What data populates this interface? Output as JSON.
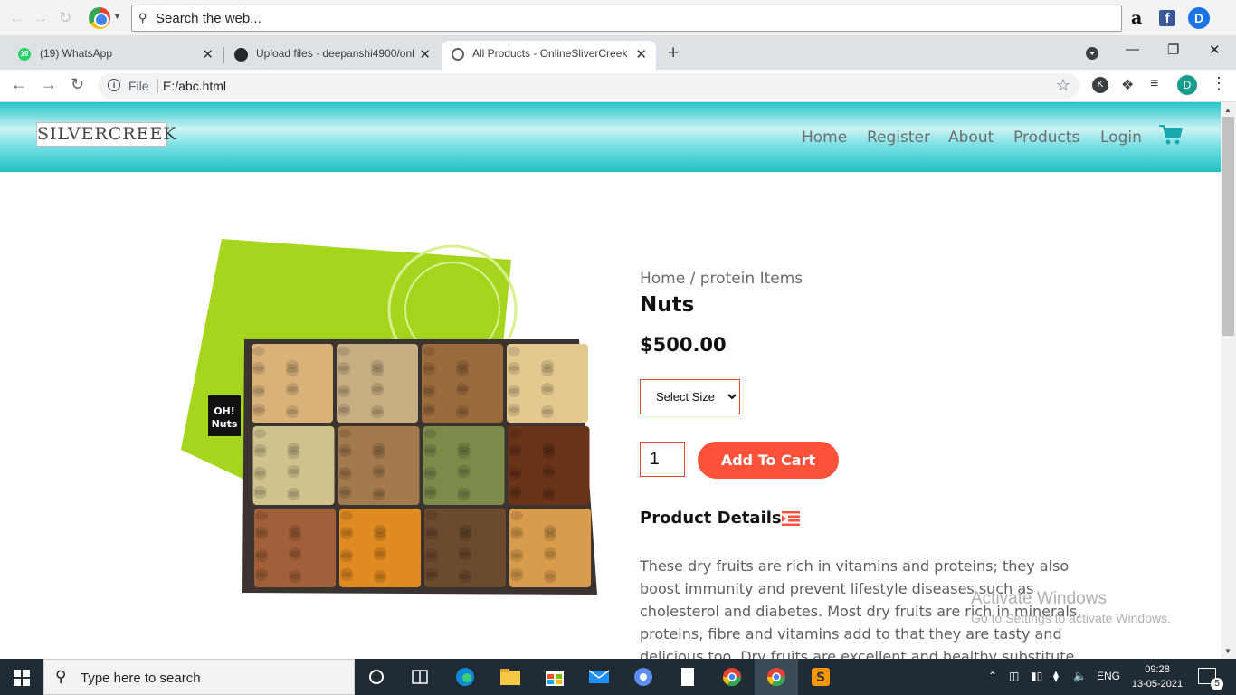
{
  "launcher": {
    "search_placeholder": "Search the web..."
  },
  "tabs": [
    {
      "label": "(19) WhatsApp",
      "badge": "19"
    },
    {
      "label": "Upload files · deepanshi4900/onl"
    },
    {
      "label": "All Products - OnlineSliverCreek"
    }
  ],
  "address": {
    "scheme": "File",
    "url": "E:/abc.html"
  },
  "profile_initial": "D",
  "site": {
    "logo_text": "SILVERCREEK",
    "nav": [
      "Home",
      "Register",
      "About",
      "Products",
      "Login"
    ],
    "brand_color": "#ff523b"
  },
  "product": {
    "breadcrumb": "Home / protein Items",
    "title": "Nuts",
    "price": "$500.00",
    "size_options": [
      "Select Size"
    ],
    "quantity": "1",
    "add_to_cart": "Add To Cart",
    "details_heading": "Product Details",
    "description": "These dry fruits are rich in vitamins and proteins; they also boost immunity and prevent lifestyle diseases such as cholesterol and diabetes. Most dry fruits are rich in minerals, proteins, fibre and vitamins add to that they are tasty and delicious too. Dry fruits are excellent and healthy substitute",
    "box_text": "OH! Nuts"
  },
  "watermark": {
    "line1": "Activate Windows",
    "line2": "Go to Settings to activate Windows."
  },
  "taskbar": {
    "search_placeholder": "Type here to search",
    "language": "ENG",
    "time": "09:28",
    "date": "13-05-2021",
    "notification_count": "5"
  }
}
